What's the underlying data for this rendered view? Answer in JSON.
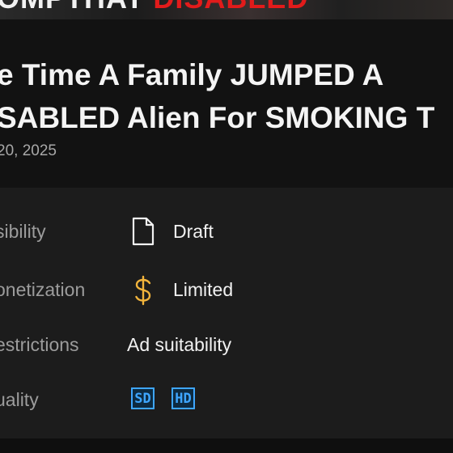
{
  "thumbnail": {
    "text_part1": "OMPTHAT",
    "text_part2": "DISABLED"
  },
  "video": {
    "title_line1": "e Time A Family JUMPED A",
    "title_line2": "SABLED Alien For SMOKING T",
    "date": "20, 2025"
  },
  "details": {
    "visibility": {
      "label": "sibility",
      "value": "Draft",
      "icon": "draft-document-icon"
    },
    "monetization": {
      "label": "onetization",
      "value": "Limited",
      "icon": "dollar-icon",
      "icon_color": "#f2b43c"
    },
    "restrictions": {
      "label": "estrictions",
      "value": "Ad suitability"
    },
    "quality": {
      "label": "uality",
      "badges": [
        "SD",
        "HD"
      ],
      "badge_color": "#3ea6ff"
    }
  }
}
